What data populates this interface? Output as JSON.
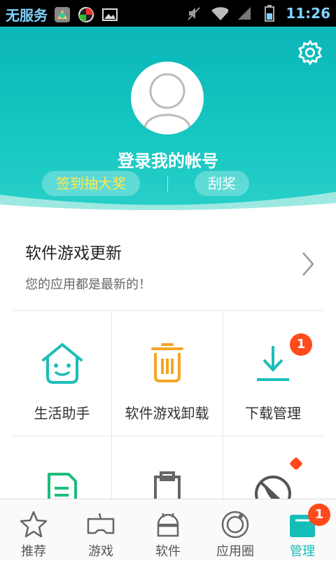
{
  "status_bar": {
    "carrier": "无服务",
    "time": "11:26"
  },
  "header": {
    "login_text": "登录我的帐号",
    "sign_in_label": "签到抽大奖",
    "scratch_label": "刮奖"
  },
  "update": {
    "title": "软件游戏更新",
    "subtitle": "您的应用都是最新的！"
  },
  "grid": {
    "items": [
      {
        "label": "生活助手",
        "icon": "smile-house-icon"
      },
      {
        "label": "软件游戏卸载",
        "icon": "trash-icon"
      },
      {
        "label": "下载管理",
        "icon": "download-icon",
        "badge": "1"
      }
    ]
  },
  "nav": {
    "items": [
      {
        "label": "推荐",
        "icon": "star-icon"
      },
      {
        "label": "游戏",
        "icon": "gamepad-icon"
      },
      {
        "label": "软件",
        "icon": "android-icon"
      },
      {
        "label": "应用圈",
        "icon": "ring-icon"
      },
      {
        "label": "管理",
        "icon": "manage-icon",
        "badge": "1"
      }
    ]
  },
  "colors": {
    "teal": "#15bdb9",
    "orange": "#f5a623",
    "badge_red": "#ff4a1c",
    "sign_yellow": "#ffe94d"
  }
}
